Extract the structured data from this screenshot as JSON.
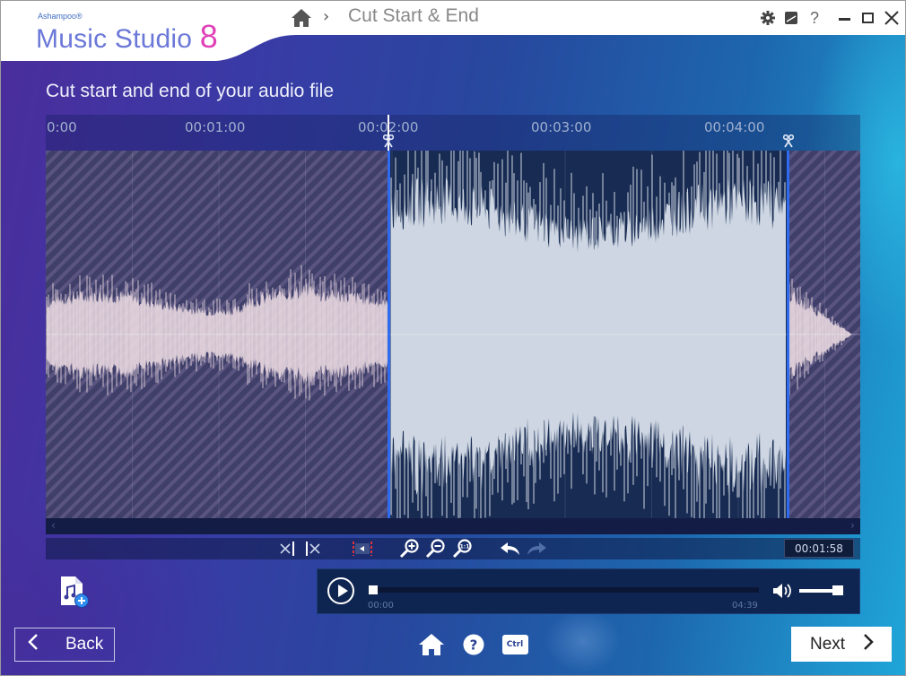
{
  "app": {
    "vendor": "Ashampoo®",
    "name": "Music Studio",
    "version": "8"
  },
  "breadcrumb": {
    "home_icon": "home-icon",
    "separator": "›",
    "current": "Cut Start & End"
  },
  "window_controls": [
    {
      "name": "settings",
      "icon": "gear-icon"
    },
    {
      "name": "feedback",
      "icon": "note-icon"
    },
    {
      "name": "help",
      "icon": "question-icon",
      "label": "?"
    },
    {
      "name": "minimize",
      "icon": "minimize-icon"
    },
    {
      "name": "maximize",
      "icon": "maximize-icon"
    },
    {
      "name": "close",
      "icon": "close-icon"
    }
  ],
  "page": {
    "title": "Cut start and end of your audio file"
  },
  "timeline": {
    "ticks": [
      "0:00",
      "00:01:00",
      "00:02:00",
      "00:03:00",
      "00:04:00"
    ],
    "total_duration": "04:39",
    "cut_start_seconds": 118,
    "cut_end_seconds": 258,
    "total_seconds": 279
  },
  "toolbar": {
    "buttons": [
      {
        "name": "cut-before-cursor",
        "icon": "cut-left-icon"
      },
      {
        "name": "cut-after-cursor",
        "icon": "cut-right-icon"
      },
      {
        "name": "play-selection",
        "icon": "play-selection-icon"
      },
      {
        "name": "zoom-in",
        "icon": "zoom-in-icon"
      },
      {
        "name": "zoom-out",
        "icon": "zoom-out-icon"
      },
      {
        "name": "zoom-reset",
        "icon": "zoom-1to1-icon",
        "label": "1:1"
      },
      {
        "name": "undo",
        "icon": "undo-icon"
      },
      {
        "name": "redo",
        "icon": "redo-icon",
        "disabled": true
      }
    ],
    "current_time": "00:01:58"
  },
  "player": {
    "position": "00:00",
    "duration": "04:39",
    "progress": 0,
    "volume": 1.0
  },
  "footer": {
    "back_label": "Back",
    "next_label": "Next",
    "icons": [
      "home-icon",
      "help-icon",
      "ctrl-icon"
    ],
    "ctrl_label": "Ctrl"
  }
}
